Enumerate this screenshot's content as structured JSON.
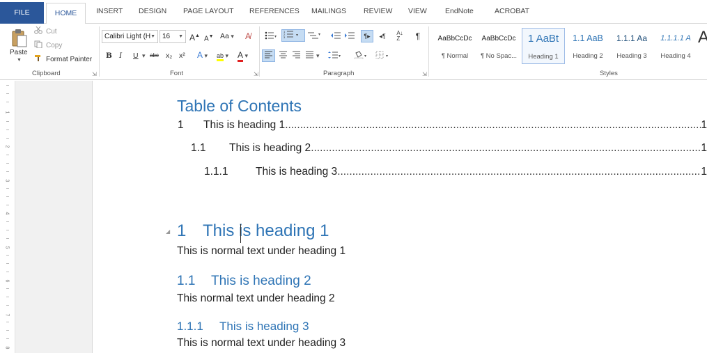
{
  "tabs": {
    "file": "FILE",
    "home": "HOME",
    "others": [
      {
        "label": "INSERT"
      },
      {
        "label": "DESIGN"
      },
      {
        "label": "PAGE LAYOUT"
      },
      {
        "label": "REFERENCES"
      },
      {
        "label": "MAILINGS"
      },
      {
        "label": "REVIEW"
      },
      {
        "label": "VIEW"
      },
      {
        "label": "EndNote"
      },
      {
        "label": "ACROBAT"
      }
    ]
  },
  "clipboard": {
    "paste": "Paste",
    "cut": "Cut",
    "copy": "Copy",
    "format_painter": "Format Painter",
    "group_label": "Clipboard"
  },
  "font": {
    "family": "Calibri Light (H",
    "size": "16",
    "grow": "A",
    "shrink": "A",
    "change_case": "Aa",
    "bold": "B",
    "italic": "I",
    "underline": "U",
    "strikethrough": "abc",
    "subscript": "x₂",
    "superscript": "x²",
    "text_effects": "A",
    "highlight": "ab",
    "font_color": "A",
    "group_label": "Font"
  },
  "paragraph": {
    "group_label": "Paragraph",
    "show_marks": "¶"
  },
  "styles": {
    "group_label": "Styles",
    "items": [
      {
        "sample": "AaBbCcDc",
        "name": "¶ Normal"
      },
      {
        "sample": "AaBbCcDc",
        "name": "¶ No Spac..."
      },
      {
        "sample": "1 AaBt",
        "name": "Heading 1"
      },
      {
        "sample": "1.1 AaB",
        "name": "Heading 2"
      },
      {
        "sample": "1.1.1 Aa",
        "name": "Heading 3"
      },
      {
        "sample": "1.1.1.1 A",
        "name": "Heading 4"
      }
    ],
    "more_sample": "A"
  },
  "document": {
    "toc_title": "Table of Contents",
    "toc": [
      {
        "num": "1",
        "text": "This is heading 1",
        "page": "1"
      },
      {
        "num": "1.1",
        "text": "This is heading 2",
        "page": "1"
      },
      {
        "num": "1.1.1",
        "text": "This is heading 3",
        "page": "1"
      }
    ],
    "heading1": {
      "num": "1",
      "text": "This is heading 1"
    },
    "body1": "This is normal text under heading 1",
    "heading2": {
      "num": "1.1",
      "text": "This is heading 2"
    },
    "body2": "This normal text under heading 2",
    "heading3": {
      "num": "1.1.1",
      "text": "This is heading 3"
    },
    "body3": "This is normal text under heading 3"
  },
  "ruler": {
    "numbers": [
      "1",
      "2",
      "3",
      "4",
      "5",
      "6",
      "7",
      "8"
    ]
  },
  "colors": {
    "accent": "#2b579a",
    "heading": "#2e74b5"
  }
}
